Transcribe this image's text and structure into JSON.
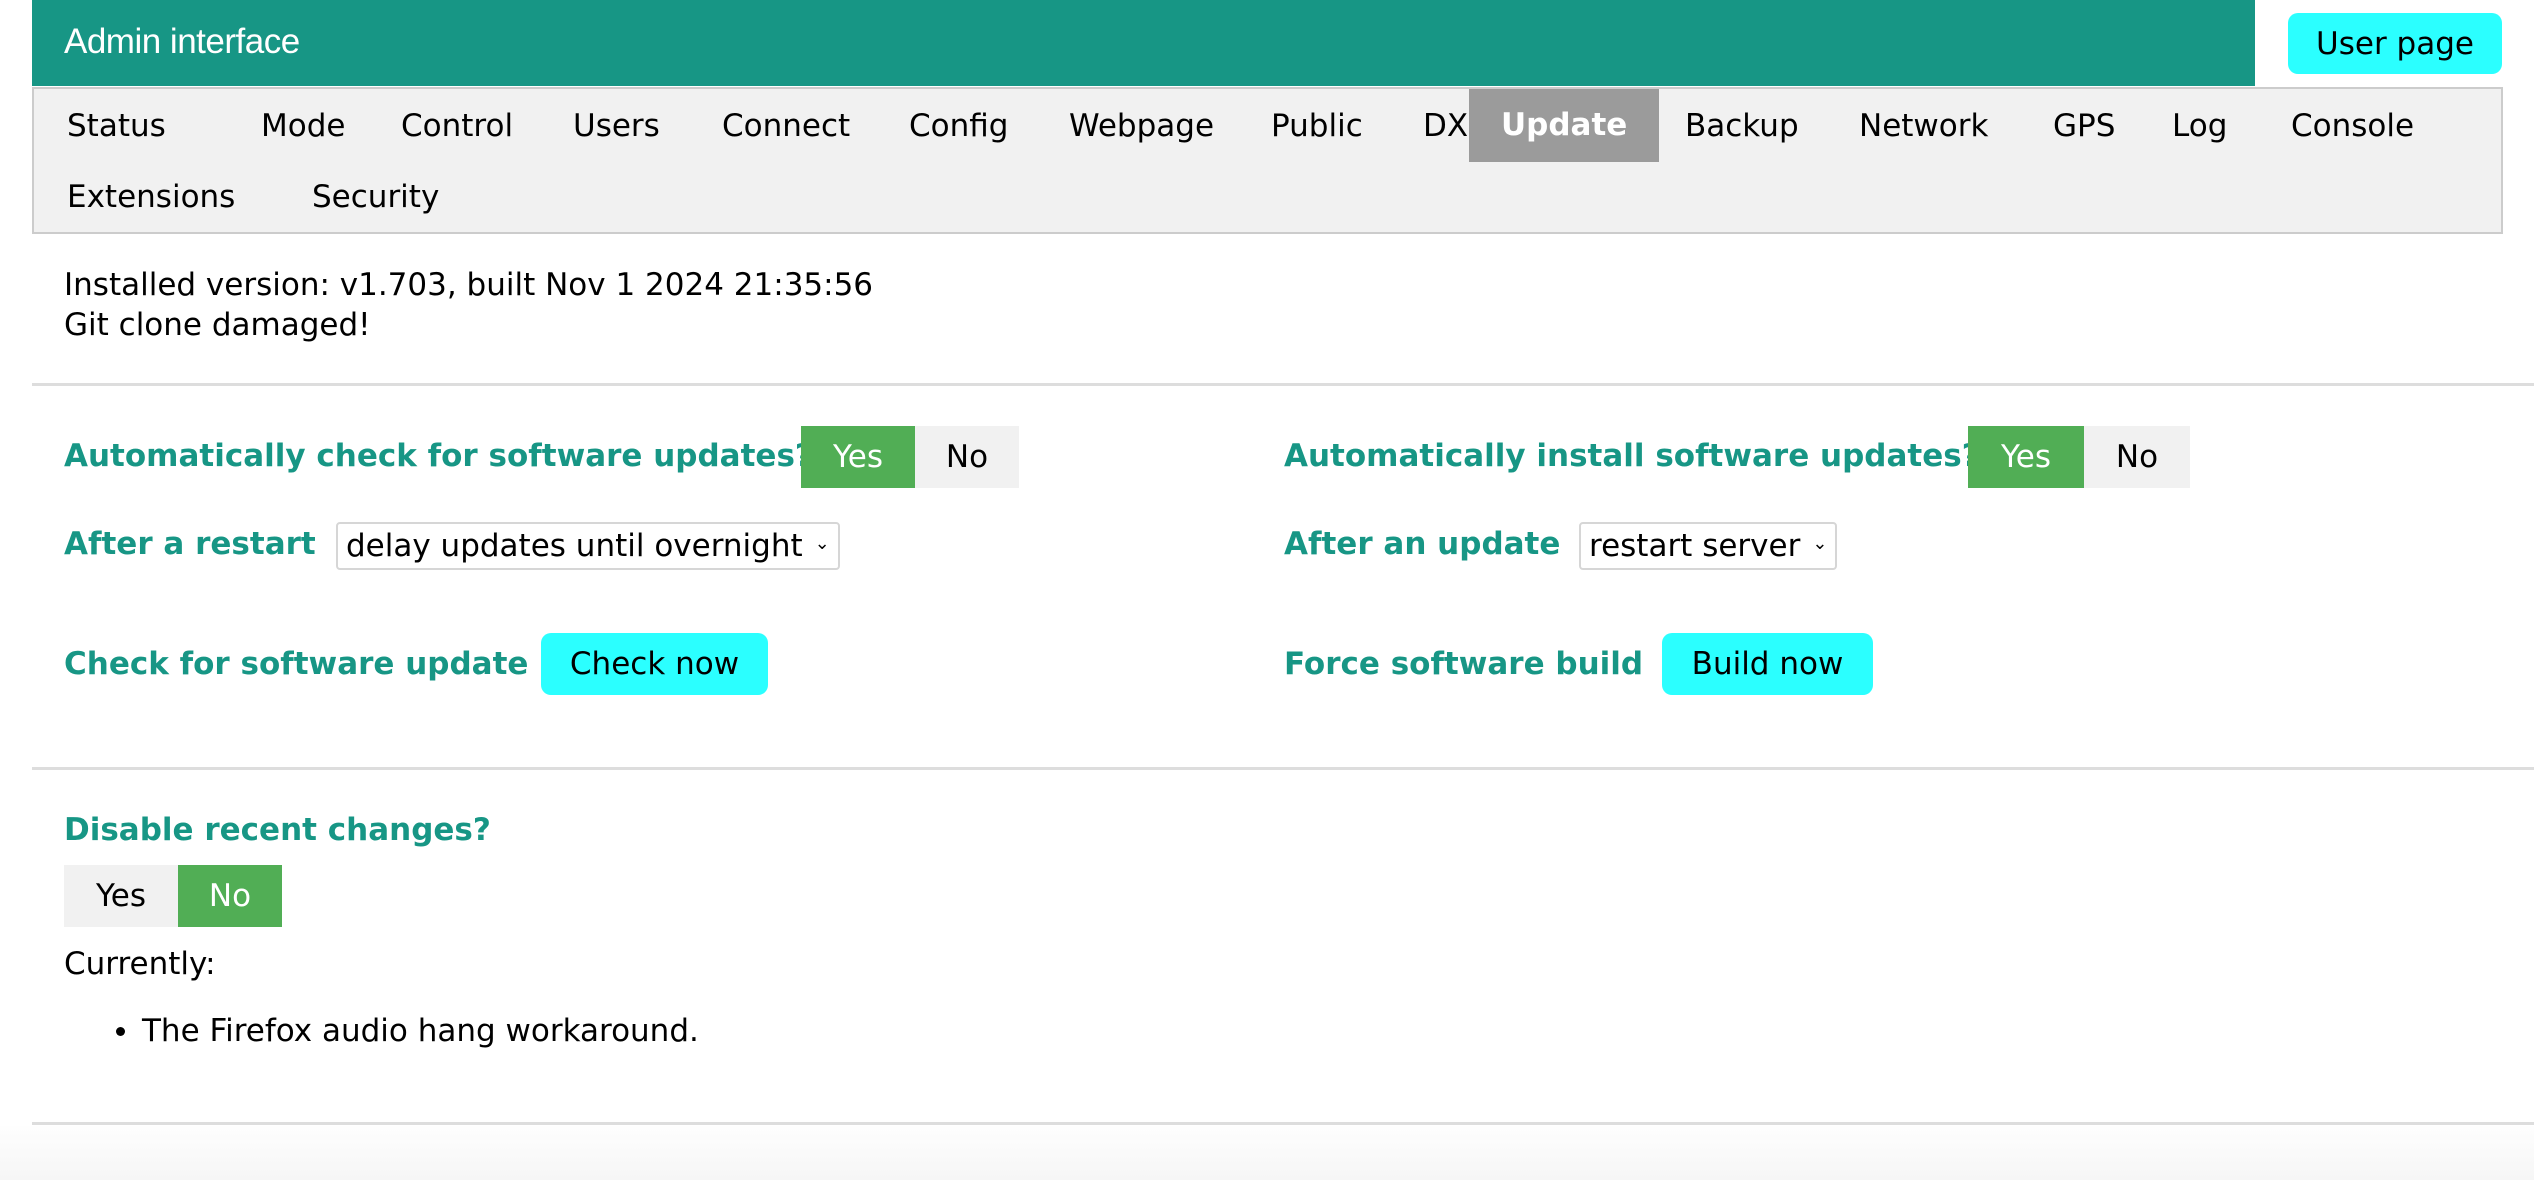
{
  "header": {
    "title": "Admin interface",
    "user_page_button": "User page"
  },
  "menu": {
    "items": [
      {
        "label": "Status",
        "active": false
      },
      {
        "label": "Mode",
        "active": false
      },
      {
        "label": "Control",
        "active": false
      },
      {
        "label": "Users",
        "active": false
      },
      {
        "label": "Connect",
        "active": false
      },
      {
        "label": "Config",
        "active": false
      },
      {
        "label": "Webpage",
        "active": false
      },
      {
        "label": "Public",
        "active": false
      },
      {
        "label": "DX",
        "active": false
      },
      {
        "label": "Update",
        "active": true
      },
      {
        "label": "Backup",
        "active": false
      },
      {
        "label": "Network",
        "active": false
      },
      {
        "label": "GPS",
        "active": false
      },
      {
        "label": "Log",
        "active": false
      },
      {
        "label": "Console",
        "active": false
      },
      {
        "label": "Extensions",
        "active": false
      },
      {
        "label": "Security",
        "active": false
      }
    ]
  },
  "version": {
    "installed": "Installed version: v1.703, built Nov 1 2024 21:35:56",
    "status": "Git clone damaged!"
  },
  "settings": {
    "auto_check": {
      "label": "Automatically check for software updates?",
      "yes": "Yes",
      "no": "No",
      "selected": "Yes"
    },
    "auto_install": {
      "label": "Automatically install software updates?",
      "yes": "Yes",
      "no": "No",
      "selected": "Yes"
    },
    "after_restart": {
      "label": "After a restart",
      "selected_option": "delay updates until overnight"
    },
    "after_update": {
      "label": "After an update",
      "selected_option": "restart server"
    },
    "check_update": {
      "label": "Check for software update",
      "button": "Check now"
    },
    "force_build": {
      "label": "Force software build",
      "button": "Build now"
    }
  },
  "recent_changes": {
    "label": "Disable recent changes?",
    "yes": "Yes",
    "no": "No",
    "selected": "No",
    "currently_label": "Currently:",
    "items": [
      "The Firefox audio hang workaround."
    ]
  },
  "colors": {
    "header_bg": "#179685",
    "label_text": "#179685",
    "toggle_on": "#51ae55",
    "toggle_off": "#f1f1f1",
    "action_button": "#2bffff",
    "menu_active": "#9b9b9b",
    "menu_bg": "#f1f1f1"
  }
}
